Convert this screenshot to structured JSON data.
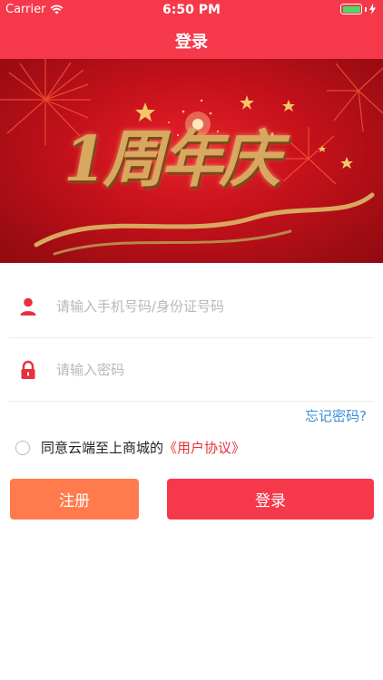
{
  "status_bar": {
    "carrier": "Carrier",
    "time": "6:50 PM"
  },
  "nav": {
    "title": "登录"
  },
  "banner": {
    "text": "1周年庆"
  },
  "form": {
    "phone_placeholder": "请输入手机号码/身份证号码",
    "password_placeholder": "请输入密码",
    "forgot_label": "忘记密码?",
    "agree_text": "同意云端至上商城的",
    "agreement_link": "《用户协议》"
  },
  "buttons": {
    "register_label": "注册",
    "login_label": "登录"
  },
  "colors": {
    "brand_red": "#f5394a",
    "register_orange": "#ff7a4d",
    "link_blue": "#3b8fd9",
    "battery_green": "#4cd964"
  }
}
